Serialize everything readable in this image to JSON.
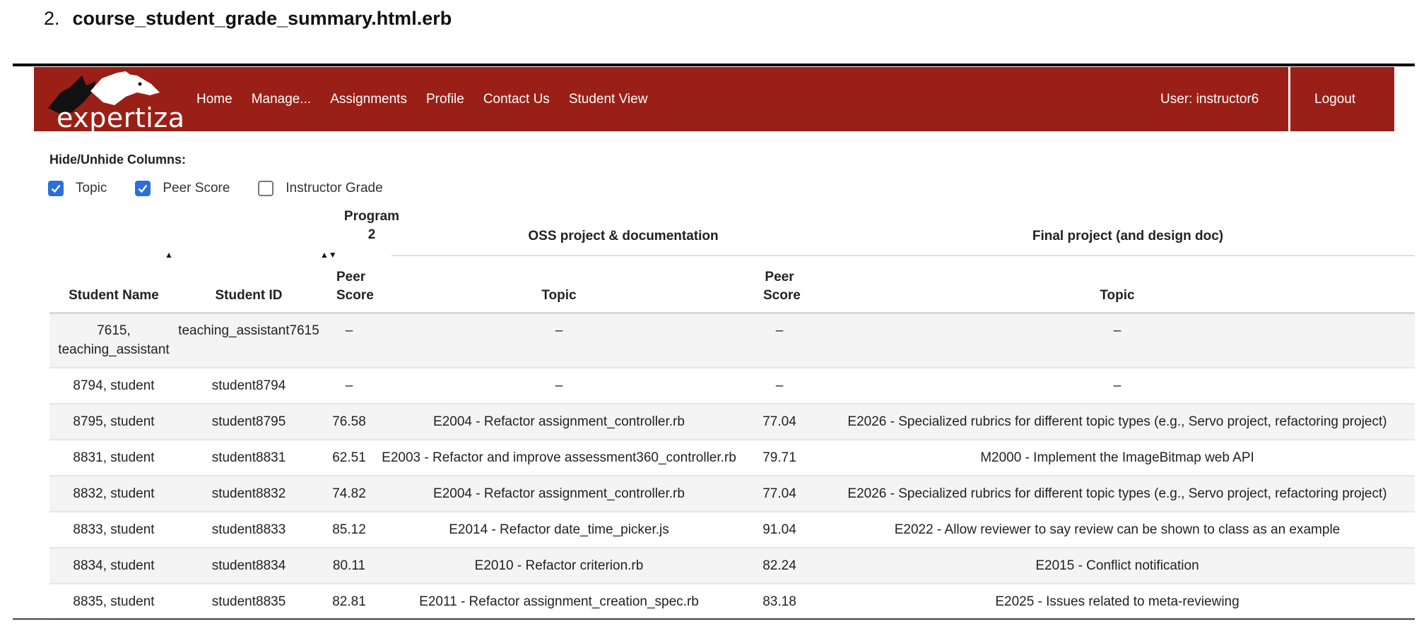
{
  "document": {
    "number": "2.",
    "filename": "course_student_grade_summary.html.erb"
  },
  "navbar": {
    "logo_text": "expertiza",
    "links": [
      "Home",
      "Manage...",
      "Assignments",
      "Profile",
      "Contact Us",
      "Student View"
    ],
    "user_label": "User: instructor6",
    "logout_label": "Logout",
    "color": "#9a1f17"
  },
  "column_toggles": {
    "label": "Hide/Unhide Columns:",
    "items": [
      {
        "label": "Topic",
        "checked": true
      },
      {
        "label": "Peer Score",
        "checked": true
      },
      {
        "label": "Instructor Grade",
        "checked": false
      }
    ]
  },
  "table": {
    "group_headers": [
      {
        "label": "Program 2"
      },
      {
        "label": "OSS project & documentation"
      },
      {
        "label": "Final project (and design doc)"
      }
    ],
    "columns": [
      "Student Name",
      "Student ID",
      "Peer Score",
      "Topic",
      "Peer Score",
      "Topic"
    ],
    "rows": [
      [
        "7615, teaching_assistant",
        "teaching_assistant7615",
        "–",
        "–",
        "–",
        "–"
      ],
      [
        "8794, student",
        "student8794",
        "–",
        "–",
        "–",
        "–"
      ],
      [
        "8795, student",
        "student8795",
        "76.58",
        "E2004 - Refactor assignment_controller.rb",
        "77.04",
        "E2026 - Specialized rubrics for different topic types (e.g., Servo project, refactoring project)"
      ],
      [
        "8831, student",
        "student8831",
        "62.51",
        "E2003 - Refactor and improve assessment360_controller.rb",
        "79.71",
        "M2000 - Implement the ImageBitmap web API"
      ],
      [
        "8832, student",
        "student8832",
        "74.82",
        "E2004 - Refactor assignment_controller.rb",
        "77.04",
        "E2026 - Specialized rubrics for different topic types (e.g., Servo project, refactoring project)"
      ],
      [
        "8833, student",
        "student8833",
        "85.12",
        "E2014 - Refactor date_time_picker.js",
        "91.04",
        "E2022 - Allow reviewer to say review can be shown to class as an example"
      ],
      [
        "8834, student",
        "student8834",
        "80.11",
        "E2010 - Refactor criterion.rb",
        "82.24",
        "E2015 - Conflict notification"
      ],
      [
        "8835, student",
        "student8835",
        "82.81",
        "E2011 - Refactor assignment_creation_spec.rb",
        "83.18",
        "E2025 - Issues related to meta-reviewing"
      ]
    ]
  }
}
